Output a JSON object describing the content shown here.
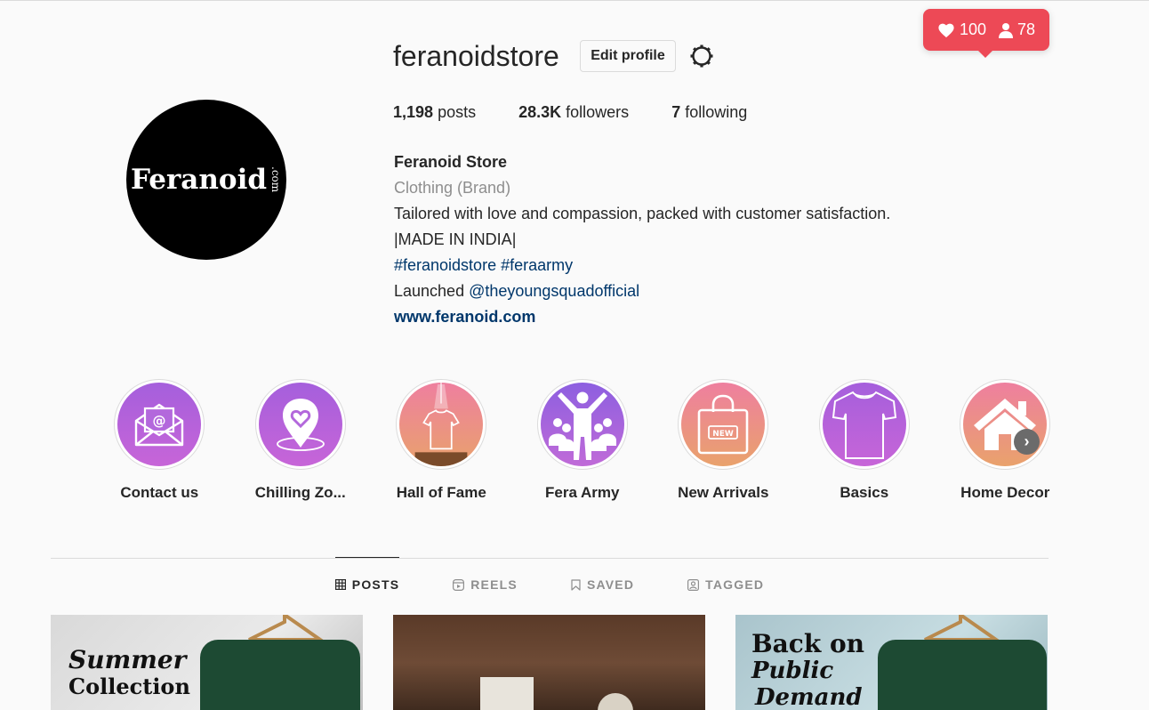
{
  "notification": {
    "likes": "100",
    "follows": "78",
    "color": "#ed4956"
  },
  "profile": {
    "username": "feranoidstore",
    "edit_label": "Edit profile",
    "avatar_logo": "Feranoid",
    "avatar_logo_suffix": ".com",
    "stats": {
      "posts_count": "1,198",
      "posts_label": "posts",
      "followers_count": "28.3K",
      "followers_label": "followers",
      "following_count": "7",
      "following_label": "following"
    },
    "bio": {
      "name": "Feranoid Store",
      "category": "Clothing (Brand)",
      "line1": "Tailored with love and compassion, packed with customer satisfaction.",
      "line2": "|MADE IN INDIA|",
      "hashtags": "#feranoidstore #feraarmy",
      "launched_prefix": "Launched ",
      "launched_mention": "@theyoungsquadofficial",
      "website": "www.feranoid.com"
    }
  },
  "highlights": [
    {
      "label": "Contact us",
      "icon": "envelope-icon"
    },
    {
      "label": "Chilling Zo...",
      "icon": "heart-pin-icon"
    },
    {
      "label": "Hall of Fame",
      "icon": "tshirt-spotlight-icon"
    },
    {
      "label": "Fera Army",
      "icon": "crowd-icon"
    },
    {
      "label": "New Arrivals",
      "icon": "shopping-bag-icon"
    },
    {
      "label": "Basics",
      "icon": "tshirt-icon"
    },
    {
      "label": "Home Decor",
      "icon": "house-icon"
    }
  ],
  "tabs": [
    {
      "label": "POSTS",
      "icon": "grid-icon",
      "active": true
    },
    {
      "label": "REELS",
      "icon": "reels-icon",
      "active": false
    },
    {
      "label": "SAVED",
      "icon": "bookmark-icon",
      "active": false
    },
    {
      "label": "TAGGED",
      "icon": "tagged-icon",
      "active": false
    }
  ],
  "posts": [
    {
      "text_line1": "Summer",
      "text_line2": "Collection"
    },
    {
      "text_line1": "",
      "text_line2": ""
    },
    {
      "text_line1": "Back on",
      "text_line2": "Public",
      "text_line3": "Demand"
    }
  ]
}
